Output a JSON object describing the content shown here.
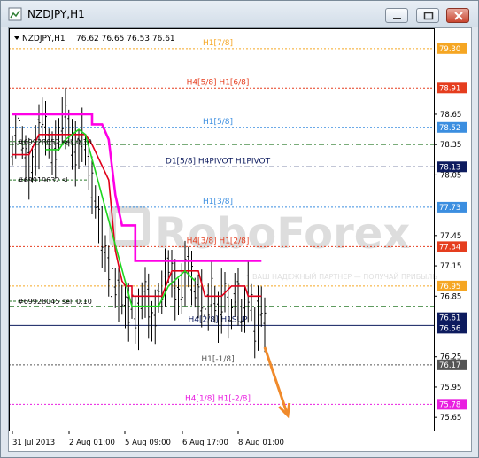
{
  "window": {
    "title": "NZDJPY,H1",
    "buttons": [
      "minimize",
      "maximize",
      "close"
    ]
  },
  "chart_header": {
    "symbol": "NZDJPY,H1",
    "ohlc": "76.62 76.65 76.53 76.61"
  },
  "watermark": {
    "brand": "RoboForex",
    "tagline": "ВАШ НАДЕЖНЫЙ ПАРТНЕР — ПОЛУЧАЙ ПРИБЫЛЬ"
  },
  "chart_data": {
    "type": "line",
    "ylim": [
      75.5,
      79.5
    ],
    "y_ticks": [
      "79.30",
      "78.91",
      "78.65",
      "78.52",
      "78.35",
      "78.13",
      "78.05",
      "77.73",
      "77.45",
      "77.34",
      "77.15",
      "76.95",
      "76.85",
      "76.61",
      "76.56",
      "76.25",
      "76.17",
      "75.95",
      "75.78",
      "75.65"
    ],
    "x_ticks": [
      "31 Jul 2013",
      "2 Aug 01:00",
      "5 Aug 09:00",
      "6 Aug 17:00",
      "8 Aug 01:00"
    ],
    "levels": [
      {
        "price": 79.3,
        "text": "H1[7/8]",
        "color": "#f5a623",
        "style": "dotted"
      },
      {
        "price": 78.91,
        "text": "H4[5/8] H1[6/8]",
        "color": "#e53d1e",
        "style": "dotted"
      },
      {
        "price": 78.52,
        "text": "H1[5/8]",
        "color": "#3b8ee0",
        "style": "dotted"
      },
      {
        "price": 78.13,
        "text": "D1[5/8] H4PIVOT H1PIVOT",
        "color": "#0d1b5e",
        "style": "dashdot"
      },
      {
        "price": 77.73,
        "text": "H1[3/8]",
        "color": "#3b8ee0",
        "style": "dotted"
      },
      {
        "price": 77.34,
        "text": "H4[3/8] H1[2/8]",
        "color": "#e53d1e",
        "style": "dotted"
      },
      {
        "price": 76.95,
        "text": "",
        "color": "#f5a623",
        "style": "dotted"
      },
      {
        "price": 76.56,
        "text": "H4[2/8] H1SUP",
        "color": "#0d1b5e",
        "style": "solid"
      },
      {
        "price": 76.17,
        "text": "H1[-1/8]",
        "color": "#555555",
        "style": "dotted"
      },
      {
        "price": 75.78,
        "text": "H4[1/8] H1[-2/8]",
        "color": "#e91ee0",
        "style": "dotted"
      }
    ],
    "extra_lines": [
      {
        "price": 78.35,
        "color": "#2a7a2a",
        "style": "dashdot"
      },
      {
        "price": 76.75,
        "color": "#2a7a2a",
        "style": "dashdot"
      }
    ],
    "orders": [
      {
        "text": "#69928652 sell 0.10",
        "price": 78.38
      },
      {
        "text": "#69919632 sl",
        "price": 78.0
      },
      {
        "text": "#69928045 sell 0.10",
        "price": 76.8
      }
    ],
    "axis_labels": [
      {
        "text": "79.30",
        "bg": "#f5a623"
      },
      {
        "text": "78.91",
        "bg": "#e53d1e"
      },
      {
        "text": "78.52",
        "bg": "#3b8ee0"
      },
      {
        "text": "78.13",
        "bg": "#0d1b5e"
      },
      {
        "text": "77.73",
        "bg": "#3b8ee0"
      },
      {
        "text": "77.34",
        "bg": "#e53d1e"
      },
      {
        "text": "76.95",
        "bg": "#f5a623"
      },
      {
        "text": "76.61",
        "bg": "#0d1b5e"
      },
      {
        "text": "76.56",
        "bg": "#0d1b5e"
      },
      {
        "text": "76.17",
        "bg": "#555555"
      },
      {
        "text": "75.78",
        "bg": "#e91ee0"
      }
    ],
    "magenta_line": [
      [
        0,
        78.65
      ],
      [
        24,
        78.65
      ],
      [
        24,
        78.55
      ],
      [
        27,
        78.55
      ],
      [
        29,
        78.4
      ],
      [
        31,
        77.85
      ],
      [
        33,
        77.55
      ],
      [
        37,
        77.55
      ],
      [
        37,
        77.2
      ],
      [
        75,
        77.2
      ]
    ],
    "red_line": [
      [
        0,
        78.25
      ],
      [
        5,
        78.25
      ],
      [
        8,
        78.45
      ],
      [
        22,
        78.45
      ],
      [
        24,
        78.35
      ],
      [
        29,
        78.0
      ],
      [
        31,
        77.3
      ],
      [
        33,
        77.0
      ],
      [
        34,
        76.95
      ],
      [
        36,
        76.95
      ],
      [
        36,
        76.85
      ],
      [
        45,
        76.85
      ],
      [
        48,
        77.1
      ],
      [
        56,
        77.1
      ],
      [
        58,
        76.85
      ],
      [
        63,
        76.85
      ],
      [
        66,
        76.95
      ],
      [
        70,
        76.95
      ],
      [
        71,
        76.85
      ],
      [
        75,
        76.85
      ]
    ],
    "green_line": [
      [
        10,
        78.3
      ],
      [
        14,
        78.3
      ],
      [
        16,
        78.4
      ],
      [
        20,
        78.5
      ],
      [
        22,
        78.45
      ],
      [
        36,
        76.75
      ],
      [
        44,
        76.75
      ],
      [
        47,
        76.95
      ],
      [
        52,
        77.1
      ],
      [
        55,
        77.0
      ]
    ],
    "arrow": {
      "from": [
        297,
        390
      ],
      "to": [
        323,
        467
      ],
      "color": "#f08a2b"
    }
  }
}
